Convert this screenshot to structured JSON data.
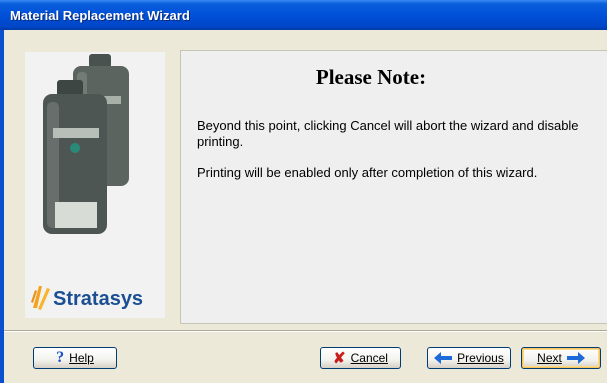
{
  "window": {
    "title": "Material Replacement Wizard"
  },
  "brand": {
    "logo_text": "Stratasys"
  },
  "note": {
    "title": "Please Note:",
    "paragraph1": "Beyond this point, clicking Cancel will abort the wizard and disable printing.",
    "paragraph2": "Printing will be enabled only after completion of this wizard."
  },
  "buttons": {
    "help": "Help",
    "cancel": "Cancel",
    "previous": "Previous",
    "next": "Next"
  },
  "colors": {
    "titlebar": "#0050d8",
    "cancel_x": "#c81e1e",
    "arrow": "#1e6ad8",
    "help_icon": "#1c50c8",
    "logo_blue": "#1b4f93",
    "logo_orange": "#f5a21b"
  },
  "icons": {
    "help": "help-question-icon",
    "cancel": "red-x-icon",
    "previous": "left-arrow-icon",
    "next": "right-arrow-icon"
  }
}
